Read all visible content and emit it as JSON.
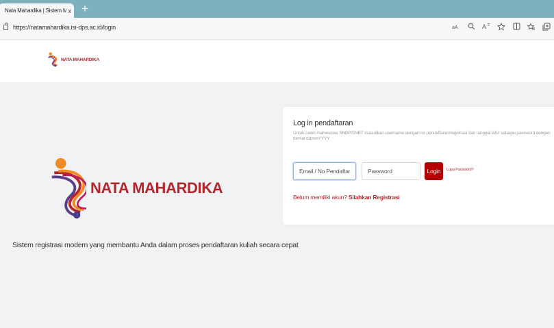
{
  "browser": {
    "tab_title": "Nata Mahardika | Sistem Manag",
    "tab_close": "x",
    "new_tab": "+",
    "url": "https://natamahardika.isi-dps.ac.id/login",
    "toolbar_icons": [
      "reader-mode-icon",
      "zoom-icon",
      "read-aloud-icon",
      "favorite-star-icon",
      "split-screen-icon",
      "favorites-icon",
      "collections-icon"
    ]
  },
  "header": {
    "logo_text": "NATA MAHARDIKA"
  },
  "brand": {
    "name": "NATA MAHARDIKA",
    "tagline": "Sistem registrasi modern yang membantu Anda dalam proses pendaftaran kuliah secara cepat"
  },
  "login": {
    "title": "Log in pendaftaran",
    "description": "Untuk calon mahasiswa SNBP/SNBT masukkan username dengan no pendaftaran/registrasi dan tanggal lahir sebagai password dengan format ddmmYYYY",
    "email_placeholder": "Email / No Pendaftaran",
    "password_placeholder": "Password",
    "login_button": "Login",
    "forgot_password": "Lupa Password?",
    "register_prompt": "Belum memiliki akun?",
    "register_link": "Silahkan Registrasi"
  },
  "colors": {
    "brand_red": "#b3262a",
    "button_red": "#b30000",
    "tabbar": "#7fb0bd",
    "page_bg": "#f1f2f4"
  }
}
